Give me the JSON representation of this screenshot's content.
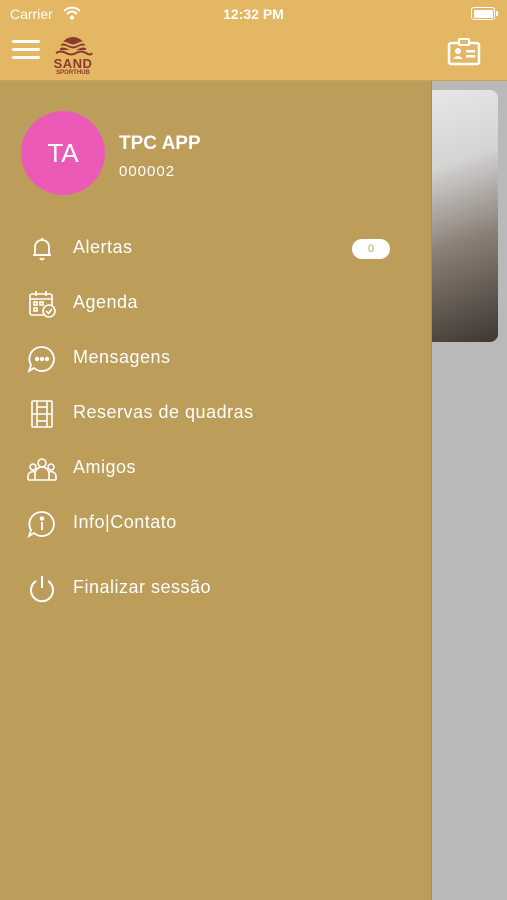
{
  "status_bar": {
    "carrier": "Carrier",
    "time": "12:32 PM"
  },
  "header": {
    "logo_text": "SAND",
    "logo_subtext": "SPORTHUB"
  },
  "profile": {
    "initials": "TA",
    "name": "TPC APP",
    "id": "000002"
  },
  "menu": {
    "items": [
      {
        "label": "Alertas",
        "icon": "bell-icon",
        "badge": "0"
      },
      {
        "label": "Agenda",
        "icon": "calendar-check-icon"
      },
      {
        "label": "Mensagens",
        "icon": "chat-icon"
      },
      {
        "label": "Reservas de quadras",
        "icon": "court-icon"
      },
      {
        "label": "Amigos",
        "icon": "friends-icon"
      },
      {
        "label": "Info|Contato",
        "icon": "info-chat-icon"
      },
      {
        "label": "Finalizar sessão",
        "icon": "power-icon"
      }
    ]
  },
  "colors": {
    "header_bg": "#e4b764",
    "drawer_bg": "#bd9d5a",
    "avatar_bg": "#ec5ab8",
    "logo": "#8b3a2e"
  }
}
